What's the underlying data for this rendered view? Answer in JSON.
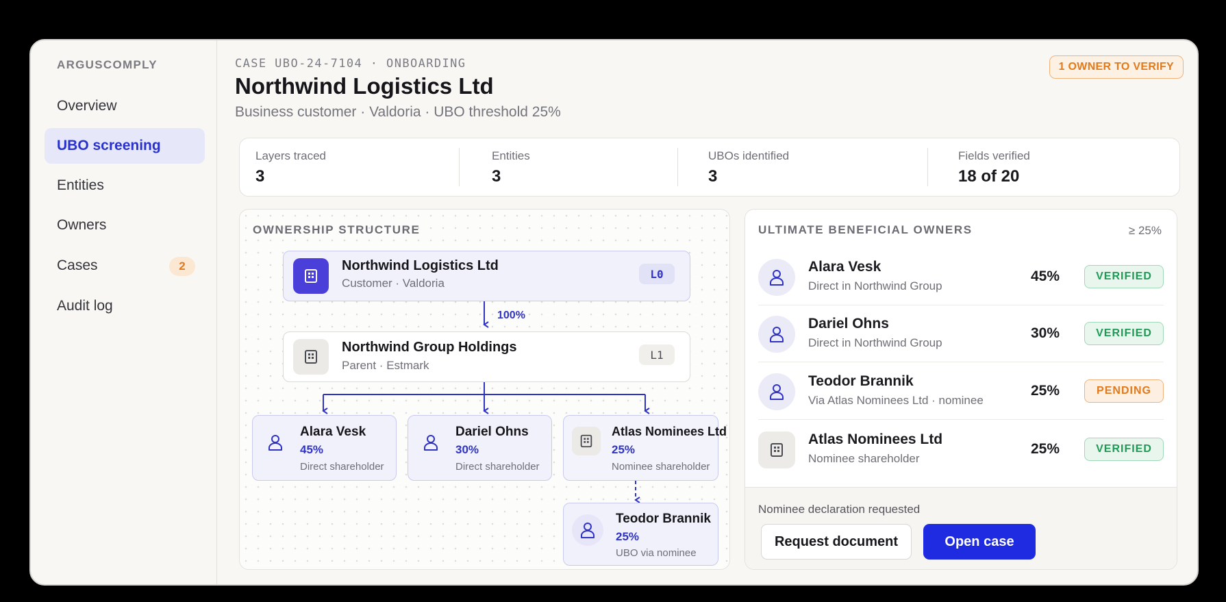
{
  "sidebar": {
    "brand": "ARGUSCOMPLY",
    "items": [
      {
        "label": "Overview"
      },
      {
        "label": "UBO screening"
      },
      {
        "label": "Entities"
      },
      {
        "label": "Owners"
      },
      {
        "label": "Cases",
        "badge": "2"
      },
      {
        "label": "Audit log"
      }
    ]
  },
  "header": {
    "case_id": "CASE UBO-24-7104 · ONBOARDING",
    "title": "Northwind Logistics Ltd",
    "subtitle": "Business customer · Valdoria · UBO threshold 25%",
    "alert": "1 OWNER TO VERIFY"
  },
  "stats": [
    {
      "label": "Layers traced",
      "value": "3"
    },
    {
      "label": "Entities",
      "value": "3"
    },
    {
      "label": "UBOs identified",
      "value": "3"
    },
    {
      "label": "Fields verified",
      "value": "18 of 20"
    }
  ],
  "structure": {
    "heading": "OWNERSHIP STRUCTURE",
    "root": {
      "name": "Northwind Logistics Ltd",
      "sub": "Customer · Valdoria",
      "level": "L0"
    },
    "edge_label": "100%",
    "parent": {
      "name": "Northwind Group Holdings",
      "sub": "Parent · Estmark",
      "level": "L1"
    },
    "children": [
      {
        "name": "Alara Vesk",
        "pct": "45%",
        "desc": "Direct shareholder"
      },
      {
        "name": "Dariel Ohns",
        "pct": "30%",
        "desc": "Direct shareholder"
      },
      {
        "name": "Atlas Nominees Ltd",
        "pct": "25%",
        "desc": "Nominee shareholder"
      }
    ],
    "nominee_owner": {
      "name": "Teodor Brannik",
      "pct": "25%",
      "desc": "UBO via nominee"
    }
  },
  "owners": {
    "heading": "ULTIMATE BENEFICIAL OWNERS",
    "threshold": "≥ 25%",
    "rows": [
      {
        "name": "Alara Vesk",
        "sub": "Direct in Northwind Group",
        "pct": "45%",
        "status": "VERIFIED"
      },
      {
        "name": "Dariel Ohns",
        "sub": "Direct in Northwind Group",
        "pct": "30%",
        "status": "VERIFIED"
      },
      {
        "name": "Teodor Brannik",
        "sub": "Via Atlas Nominees Ltd · nominee",
        "pct": "25%",
        "status": "PENDING"
      },
      {
        "name": "Atlas Nominees Ltd",
        "sub": "Nominee shareholder",
        "pct": "25%",
        "status": "VERIFIED"
      }
    ],
    "footer_note": "Nominee declaration requested",
    "secondary_button": "Request document",
    "primary_button": "Open case"
  },
  "colors": {
    "accent": "#1f2be0",
    "verified": "#1f9a55",
    "pending": "#e07a1d"
  }
}
